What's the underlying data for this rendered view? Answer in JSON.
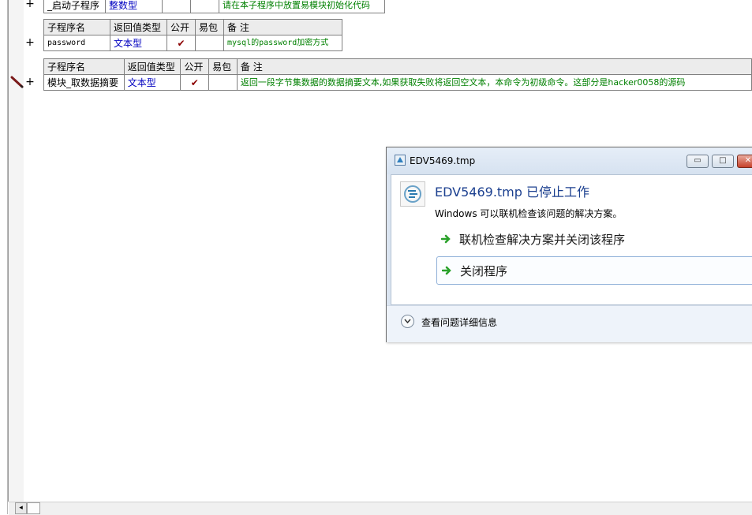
{
  "tables": [
    {
      "rows": [
        [
          "_启动子程序",
          "整数型",
          "",
          "",
          "请在本子程序中放置易模块初始化代码"
        ]
      ]
    },
    {
      "header": [
        "子程序名",
        "返回值类型",
        "公开",
        "易包",
        "备 注"
      ],
      "rows": [
        [
          "password",
          "文本型",
          "✔",
          "",
          "mysql的password加密方式"
        ]
      ]
    },
    {
      "header": [
        "子程序名",
        "返回值类型",
        "公开",
        "易包",
        "备 注"
      ],
      "rows": [
        [
          "模块_取数据摘要",
          "文本型",
          "✔",
          "",
          "返回一段字节集数据的数据摘要文本,如果获取失败将返回空文本，本命令为初级命令。这部分是hacker0058的源码"
        ]
      ]
    }
  ],
  "gutter": {
    "plus": "+"
  },
  "scrollbar": {
    "left_arrow": "◂"
  },
  "dialog": {
    "title": "EDV5469.tmp",
    "heading": "EDV5469.tmp 已停止工作",
    "description": "Windows 可以联机检查该问题的解决方案。",
    "options": [
      {
        "label": "联机检查解决方案并关闭该程序"
      },
      {
        "label": "关闭程序"
      }
    ],
    "footer": "查看问题详细信息",
    "buttons": {
      "minimize": "▭",
      "maximize": "□",
      "close": "✕"
    }
  },
  "colors": {
    "blue_text": "#0000c0",
    "green_text": "#008000",
    "check": "#8b0000",
    "dialog_heading": "#1b3f8f",
    "arrow_green": "#2aa12a"
  }
}
